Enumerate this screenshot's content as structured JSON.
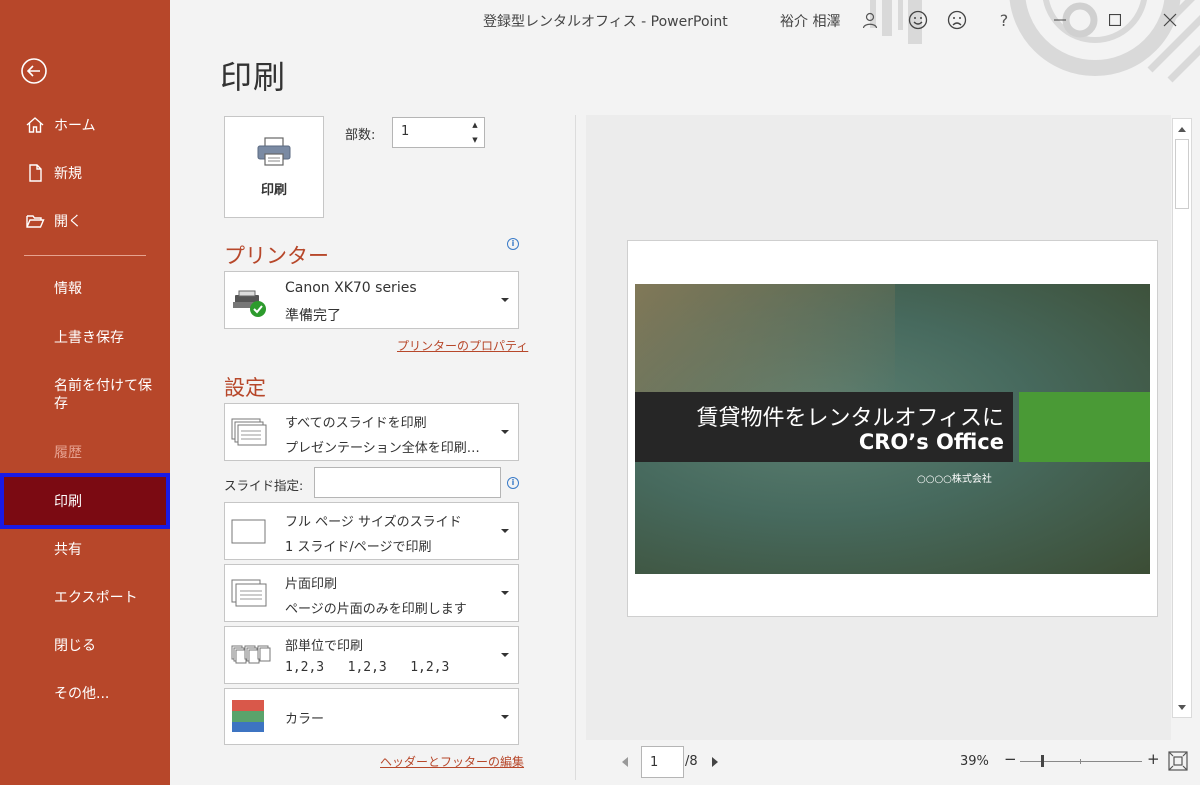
{
  "window": {
    "title": "登録型レンタルオフィス  -  PowerPoint",
    "user": "裕介 相澤",
    "help": "?"
  },
  "nav": {
    "items": [
      {
        "label": "ホーム"
      },
      {
        "label": "新規"
      },
      {
        "label": "開く"
      },
      {
        "label": "情報"
      },
      {
        "label": "上書き保存"
      },
      {
        "label": "名前を付けて保存"
      },
      {
        "label": "履歴"
      },
      {
        "label": "印刷"
      },
      {
        "label": "共有"
      },
      {
        "label": "エクスポート"
      },
      {
        "label": "閉じる"
      },
      {
        "label": "その他..."
      }
    ],
    "selected": "印刷"
  },
  "page": {
    "title": "印刷",
    "print_button": "印刷",
    "copies_label": "部数:",
    "copies_value": "1"
  },
  "printer": {
    "section_title": "プリンター",
    "name": "Canon XK70 series",
    "status": "準備完了",
    "properties_link": "プリンターのプロパティ"
  },
  "settings": {
    "section_title": "設定",
    "range": {
      "title": "すべてのスライドを印刷",
      "subtitle": "プレゼンテーション全体を印刷…"
    },
    "slides_label": "スライド指定:",
    "slides_value": "",
    "layout": {
      "title": "フル ページ サイズのスライド",
      "subtitle": "1 スライド/ページで印刷"
    },
    "sides": {
      "title": "片面印刷",
      "subtitle": "ページの片面のみを印刷します"
    },
    "collate": {
      "title": "部単位で印刷",
      "subtitle": "1,2,3   1,2,3   1,2,3"
    },
    "color": {
      "title": "カラー"
    },
    "header_footer_link": "ヘッダーとフッターの編集"
  },
  "preview": {
    "slide_title_line1": "賃貸物件をレンタルオフィスに",
    "slide_title_line2": "CRO’s Office",
    "slide_company": "○○○○株式会社",
    "page_current": "1",
    "page_total": "/8",
    "zoom": "39%",
    "zoom_minus": "−",
    "zoom_plus": "+"
  },
  "colors": {
    "accent": "#b7472a",
    "selected_nav": "#7b0a12",
    "selection_outline": "#1a1ae6",
    "slide_green": "#4a9a36",
    "slide_band": "#262626"
  },
  "icons": {
    "back": "back-arrow-icon",
    "home": "home-icon",
    "new": "new-file-icon",
    "open": "open-folder-icon",
    "printer": "printer-icon",
    "info": "info-icon",
    "scroll_up": "scroll-up-icon",
    "scroll_down": "scroll-down-icon",
    "fit": "zoom-to-page-icon"
  }
}
